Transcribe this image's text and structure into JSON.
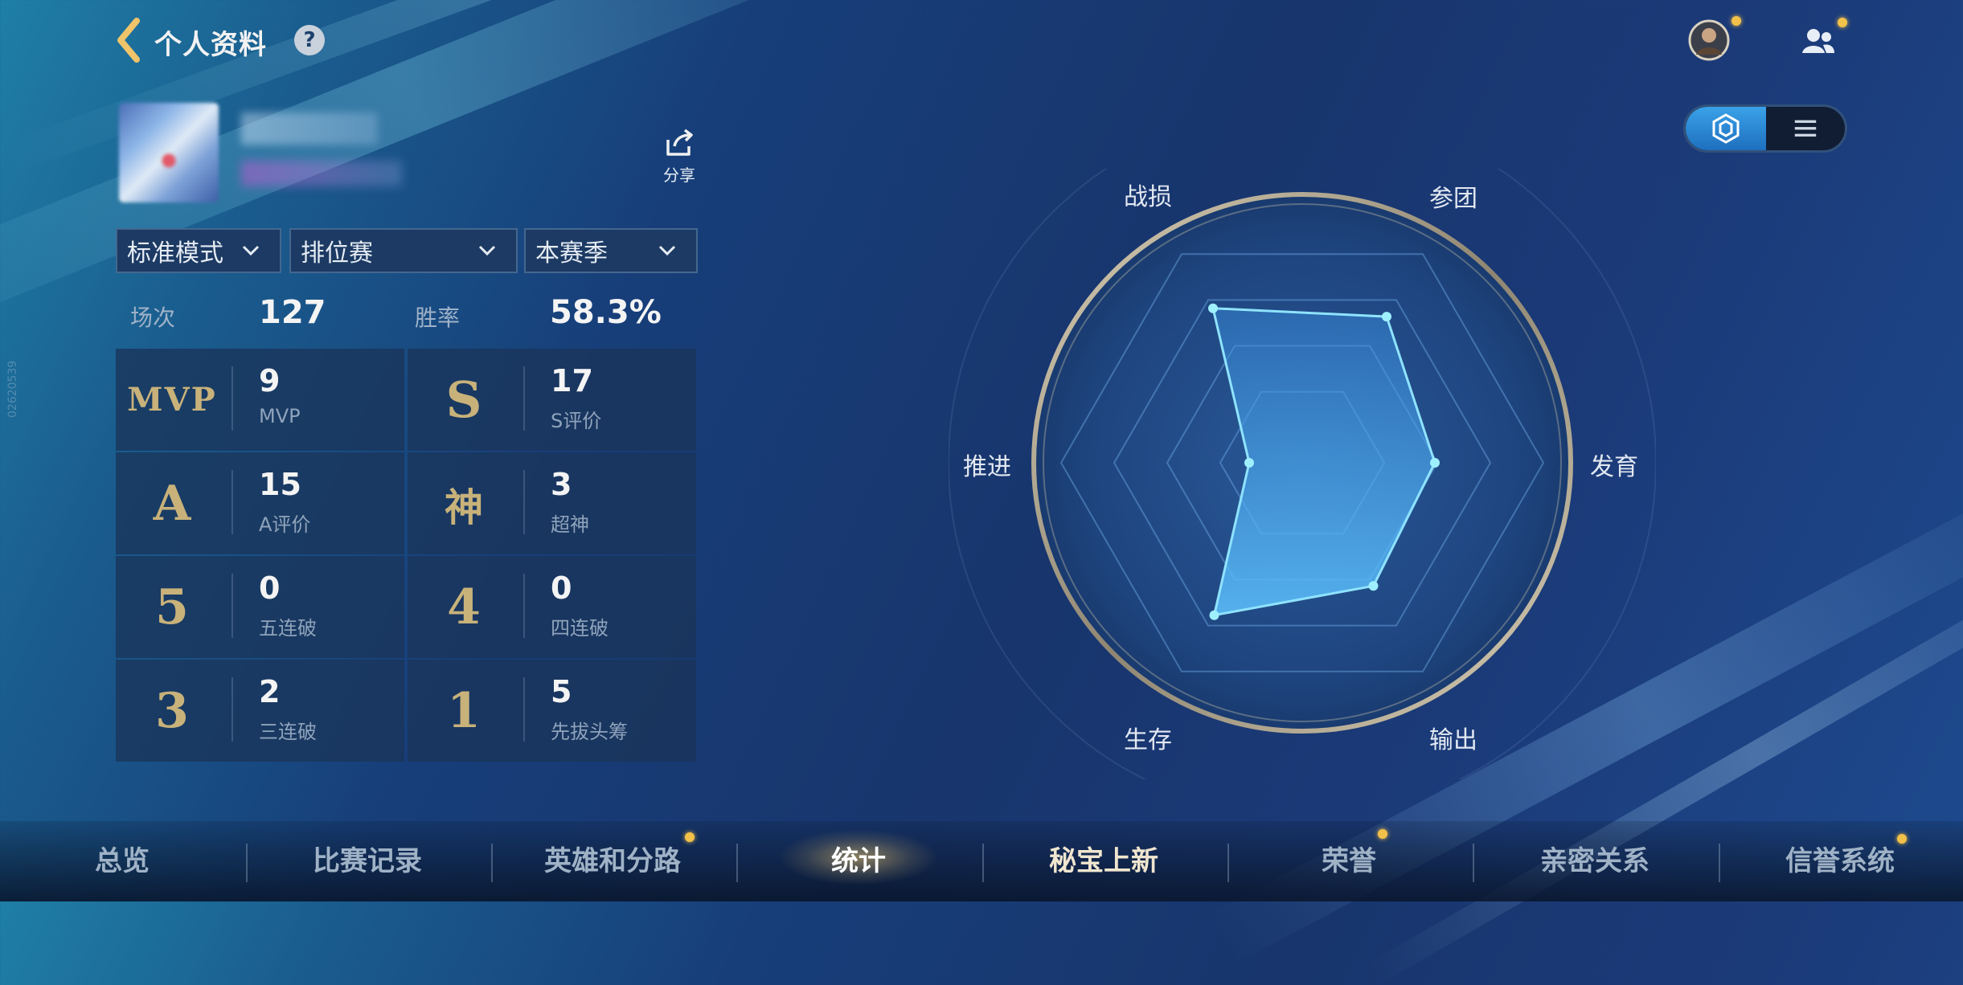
{
  "header": {
    "title": "个人资料",
    "help": "?"
  },
  "profile": {
    "share_label": "分享"
  },
  "filters": [
    {
      "label": "标准模式"
    },
    {
      "label": "排位赛"
    },
    {
      "label": "本赛季"
    }
  ],
  "summary": {
    "matches_label": "场次",
    "matches_value": "127",
    "winrate_label": "胜率",
    "winrate_value": "58.3%"
  },
  "stats": [
    {
      "icon": "MVP",
      "value": "9",
      "label": "MVP"
    },
    {
      "icon": "S",
      "value": "17",
      "label": "S评价"
    },
    {
      "icon": "A",
      "value": "15",
      "label": "A评价"
    },
    {
      "icon": "神",
      "value": "3",
      "label": "超神"
    },
    {
      "icon": "5",
      "value": "0",
      "label": "五连破"
    },
    {
      "icon": "4",
      "value": "0",
      "label": "四连破"
    },
    {
      "icon": "3",
      "value": "2",
      "label": "三连破"
    },
    {
      "icon": "1",
      "value": "5",
      "label": "先拔头筹"
    }
  ],
  "radar": {
    "axes": [
      "战损",
      "参团",
      "发育",
      "输出",
      "生存",
      "推进"
    ],
    "values": [
      0.74,
      0.7,
      0.55,
      0.59,
      0.73,
      0.22
    ]
  },
  "nav": {
    "tabs": [
      "总览",
      "比赛记录",
      "英雄和分路",
      "统计",
      "秘宝上新",
      "荣誉",
      "亲密关系",
      "信誉系统"
    ],
    "active_index": 3
  },
  "watermark": "02620539",
  "colors": {
    "accent": "#3aa2e8",
    "gold": "#c8b27a",
    "badge": "#f2c14a"
  }
}
